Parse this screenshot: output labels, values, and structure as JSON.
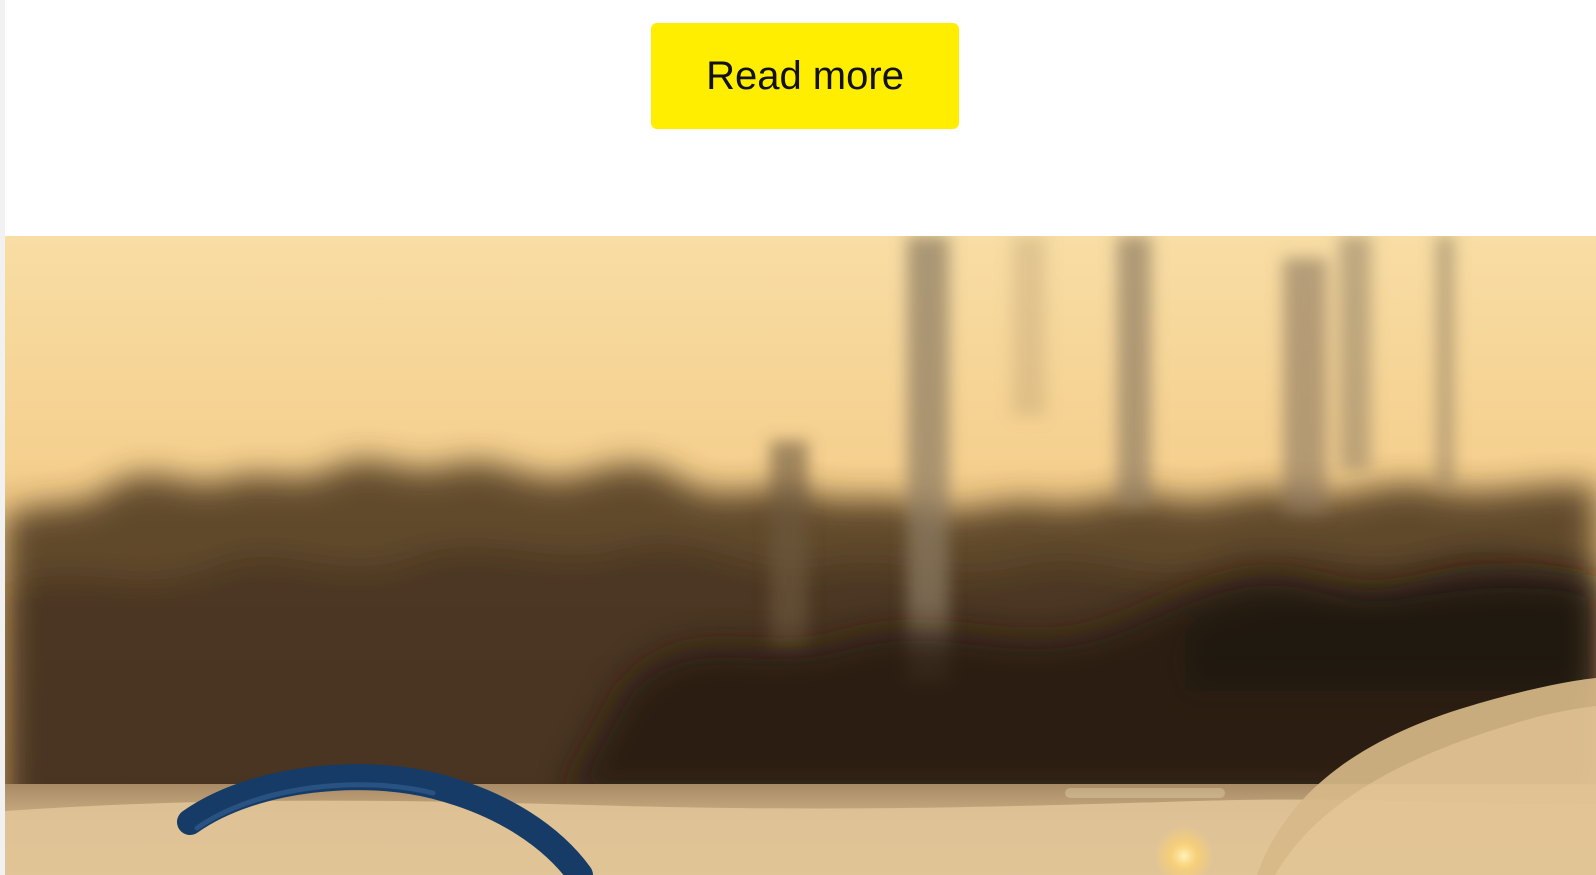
{
  "cta": {
    "read_more_label": "Read more"
  },
  "hero": {
    "image_icon": "blurred-industrial-sunset-photo",
    "accent_color": "#ffee00"
  }
}
